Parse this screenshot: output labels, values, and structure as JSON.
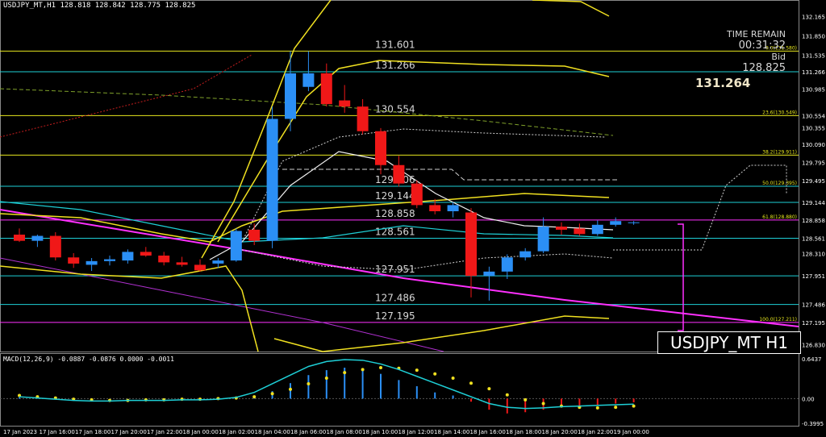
{
  "header": {
    "symbol_ohlc": "USDJPY_MT,H1  128.818 128.842 128.775 128.825"
  },
  "macd_label": "MACD(12,26,9) -0.0887 -0.0876 0.0000 -0.0011",
  "time_remain": {
    "label": "TIME REMAIN",
    "value": "00:31:32",
    "bid_label": "Bid",
    "bid_value": "128.825"
  },
  "big_price": "131.264",
  "symbol_box": "USDJPY_MT H1",
  "price_scale": [
    "132.165",
    "131.850",
    "131.535",
    "131.266",
    "130.985",
    "130.554",
    "130.355",
    "130.090",
    "129.795",
    "129.495",
    "129.144",
    "128.858",
    "128.561",
    "128.310",
    "127.951",
    "127.486",
    "127.195",
    "126.830"
  ],
  "macd_scale": [
    "0.6437",
    "0.00",
    "-0.3995"
  ],
  "time_labels": [
    "17 Jan 2023",
    "17 Jan 16:00",
    "17 Jan 18:00",
    "17 Jan 20:00",
    "17 Jan 22:00",
    "18 Jan 00:00",
    "18 Jan 02:00",
    "18 Jan 04:00",
    "18 Jan 06:00",
    "18 Jan 08:00",
    "18 Jan 10:00",
    "18 Jan 12:00",
    "18 Jan 14:00",
    "18 Jan 16:00",
    "18 Jan 18:00",
    "18 Jan 20:00",
    "18 Jan 22:00",
    "19 Jan 00:00"
  ],
  "levels": [
    {
      "price": 131.601,
      "label": "131.601",
      "color": "#e6e61e",
      "fib": "0.0(131.580)"
    },
    {
      "price": 131.266,
      "label": "131.266",
      "color": "#1ecfd6",
      "fib": ""
    },
    {
      "price": 130.554,
      "label": "130.554",
      "color": "#e6e61e",
      "fib": "23.6(130.549)"
    },
    {
      "price": 129.911,
      "label": "",
      "color": "#e6e61e",
      "fib": "38.2(129.911)"
    },
    {
      "price": 129.406,
      "label": "129.406",
      "color": "#1ecfd6",
      "fib": "50.0(129.395)"
    },
    {
      "price": 129.144,
      "label": "129.144",
      "color": "#1ecfd6",
      "fib": ""
    },
    {
      "price": 128.858,
      "label": "128.858",
      "color": "#ff30ff",
      "fib": "61.8(128.880)"
    },
    {
      "price": 128.561,
      "label": "128.561",
      "color": "#1ecfd6",
      "fib": ""
    },
    {
      "price": 127.951,
      "label": "127.951",
      "color": "#1ecfd6",
      "fib": ""
    },
    {
      "price": 127.486,
      "label": "127.486",
      "color": "#1ecfd6",
      "fib": ""
    },
    {
      "price": 127.195,
      "label": "127.195",
      "color": "#ff30ff",
      "fib": "100.0(127.211)"
    }
  ],
  "chart_data": {
    "type": "candlestick",
    "series_name": "USDJPY_MT,H1",
    "ylim": [
      126.8,
      132.3
    ],
    "candles": [
      {
        "o": 128.62,
        "h": 128.72,
        "l": 128.5,
        "c": 128.52
      },
      {
        "o": 128.52,
        "h": 128.62,
        "l": 128.42,
        "c": 128.6
      },
      {
        "o": 128.6,
        "h": 128.66,
        "l": 128.2,
        "c": 128.25
      },
      {
        "o": 128.25,
        "h": 128.32,
        "l": 128.08,
        "c": 128.15
      },
      {
        "o": 128.13,
        "h": 128.24,
        "l": 128.03,
        "c": 128.19
      },
      {
        "o": 128.19,
        "h": 128.28,
        "l": 128.12,
        "c": 128.22
      },
      {
        "o": 128.2,
        "h": 128.38,
        "l": 128.15,
        "c": 128.34
      },
      {
        "o": 128.34,
        "h": 128.42,
        "l": 128.26,
        "c": 128.28
      },
      {
        "o": 128.28,
        "h": 128.34,
        "l": 128.12,
        "c": 128.17
      },
      {
        "o": 128.17,
        "h": 128.26,
        "l": 128.1,
        "c": 128.13
      },
      {
        "o": 128.13,
        "h": 128.22,
        "l": 128.02,
        "c": 128.04
      },
      {
        "o": 128.15,
        "h": 128.24,
        "l": 128.08,
        "c": 128.2
      },
      {
        "o": 128.2,
        "h": 128.72,
        "l": 128.18,
        "c": 128.68
      },
      {
        "o": 128.7,
        "h": 128.8,
        "l": 128.45,
        "c": 128.52
      },
      {
        "o": 128.52,
        "h": 130.7,
        "l": 128.4,
        "c": 130.5
      },
      {
        "o": 130.5,
        "h": 131.6,
        "l": 130.3,
        "c": 131.24
      },
      {
        "o": 131.02,
        "h": 131.6,
        "l": 130.95,
        "c": 131.24
      },
      {
        "o": 131.24,
        "h": 131.4,
        "l": 130.7,
        "c": 130.74
      },
      {
        "o": 130.8,
        "h": 131.05,
        "l": 130.6,
        "c": 130.7
      },
      {
        "o": 130.7,
        "h": 130.82,
        "l": 130.25,
        "c": 130.3
      },
      {
        "o": 130.3,
        "h": 130.35,
        "l": 129.6,
        "c": 129.75
      },
      {
        "o": 129.75,
        "h": 129.9,
        "l": 129.4,
        "c": 129.45
      },
      {
        "o": 129.45,
        "h": 129.5,
        "l": 129.05,
        "c": 129.1
      },
      {
        "o": 129.1,
        "h": 129.2,
        "l": 128.95,
        "c": 129.0
      },
      {
        "o": 129.0,
        "h": 129.15,
        "l": 128.9,
        "c": 129.1
      },
      {
        "o": 128.98,
        "h": 129.05,
        "l": 127.6,
        "c": 127.95
      },
      {
        "o": 127.95,
        "h": 128.1,
        "l": 127.55,
        "c": 128.02
      },
      {
        "o": 128.02,
        "h": 128.3,
        "l": 127.9,
        "c": 128.25
      },
      {
        "o": 128.25,
        "h": 128.4,
        "l": 128.2,
        "c": 128.35
      },
      {
        "o": 128.35,
        "h": 128.9,
        "l": 128.32,
        "c": 128.75
      },
      {
        "o": 128.75,
        "h": 128.82,
        "l": 128.62,
        "c": 128.7
      },
      {
        "o": 128.72,
        "h": 128.8,
        "l": 128.6,
        "c": 128.63
      },
      {
        "o": 128.63,
        "h": 128.85,
        "l": 128.6,
        "c": 128.78
      },
      {
        "o": 128.78,
        "h": 128.9,
        "l": 128.75,
        "c": 128.84
      },
      {
        "o": 128.82,
        "h": 128.84,
        "l": 128.78,
        "c": 128.82
      }
    ],
    "macd_hist": [
      0.02,
      0.01,
      0.0,
      -0.01,
      0.0,
      0.0,
      0.0,
      0.0,
      0.0,
      0.0,
      0.0,
      0.0,
      0.0,
      0.05,
      0.12,
      0.25,
      0.38,
      0.46,
      0.5,
      0.47,
      0.4,
      0.3,
      0.2,
      0.1,
      0.05,
      -0.05,
      -0.18,
      -0.24,
      -0.22,
      -0.18,
      -0.14,
      -0.12,
      -0.1,
      -0.08,
      -0.06
    ],
    "macd_signal": [
      0.05,
      0.03,
      0.01,
      -0.01,
      -0.02,
      -0.03,
      -0.03,
      -0.02,
      -0.02,
      -0.01,
      -0.01,
      0.0,
      0.01,
      0.03,
      0.08,
      0.15,
      0.24,
      0.33,
      0.42,
      0.47,
      0.5,
      0.49,
      0.46,
      0.4,
      0.33,
      0.25,
      0.16,
      0.06,
      -0.02,
      -0.08,
      -0.12,
      -0.14,
      -0.15,
      -0.14,
      -0.12
    ],
    "macd_main": [
      0.03,
      0.01,
      -0.01,
      -0.03,
      -0.04,
      -0.04,
      -0.03,
      -0.03,
      -0.03,
      -0.02,
      -0.02,
      -0.01,
      0.02,
      0.1,
      0.24,
      0.38,
      0.52,
      0.6,
      0.63,
      0.62,
      0.56,
      0.47,
      0.36,
      0.25,
      0.14,
      0.03,
      -0.08,
      -0.14,
      -0.16,
      -0.15,
      -0.13,
      -0.12,
      -0.11,
      -0.1,
      -0.09
    ]
  }
}
